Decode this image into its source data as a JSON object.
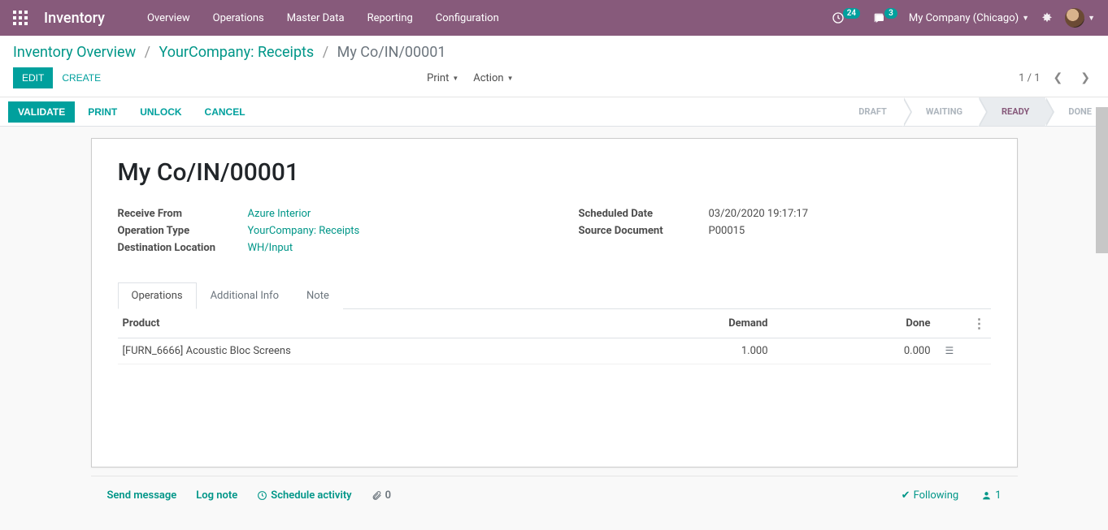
{
  "nav": {
    "brand": "Inventory",
    "menu": [
      "Overview",
      "Operations",
      "Master Data",
      "Reporting",
      "Configuration"
    ],
    "activity_count": "24",
    "msg_count": "3",
    "company": "My Company (Chicago)"
  },
  "breadcrumb": {
    "items": [
      "Inventory Overview",
      "YourCompany: Receipts"
    ],
    "current": "My Co/IN/00001"
  },
  "buttons": {
    "edit": "EDIT",
    "create": "CREATE",
    "print": "Print",
    "action": "Action"
  },
  "pager": {
    "text": "1 / 1"
  },
  "status": {
    "validate": "VALIDATE",
    "print": "PRINT",
    "unlock": "UNLOCK",
    "cancel": "CANCEL",
    "steps": [
      "DRAFT",
      "WAITING",
      "READY",
      "DONE"
    ],
    "active_step": "READY"
  },
  "record": {
    "name": "My Co/IN/00001",
    "fields_left": {
      "receive_from": {
        "label": "Receive From",
        "value": "Azure Interior",
        "link": true
      },
      "operation_type": {
        "label": "Operation Type",
        "value": "YourCompany: Receipts",
        "link": true
      },
      "destination_location": {
        "label": "Destination Location",
        "value": "WH/Input",
        "link": true
      }
    },
    "fields_right": {
      "scheduled_date": {
        "label": "Scheduled Date",
        "value": "03/20/2020 19:17:17"
      },
      "source_document": {
        "label": "Source Document",
        "value": "P00015"
      }
    }
  },
  "tabs": [
    "Operations",
    "Additional Info",
    "Note"
  ],
  "table": {
    "headers": {
      "product": "Product",
      "demand": "Demand",
      "done": "Done"
    },
    "rows": [
      {
        "product": "[FURN_6666] Acoustic Bloc Screens",
        "demand": "1.000",
        "done": "0.000"
      }
    ]
  },
  "chatter": {
    "send": "Send message",
    "log": "Log note",
    "schedule": "Schedule activity",
    "attach_count": "0",
    "following": "Following",
    "followers": "1"
  }
}
